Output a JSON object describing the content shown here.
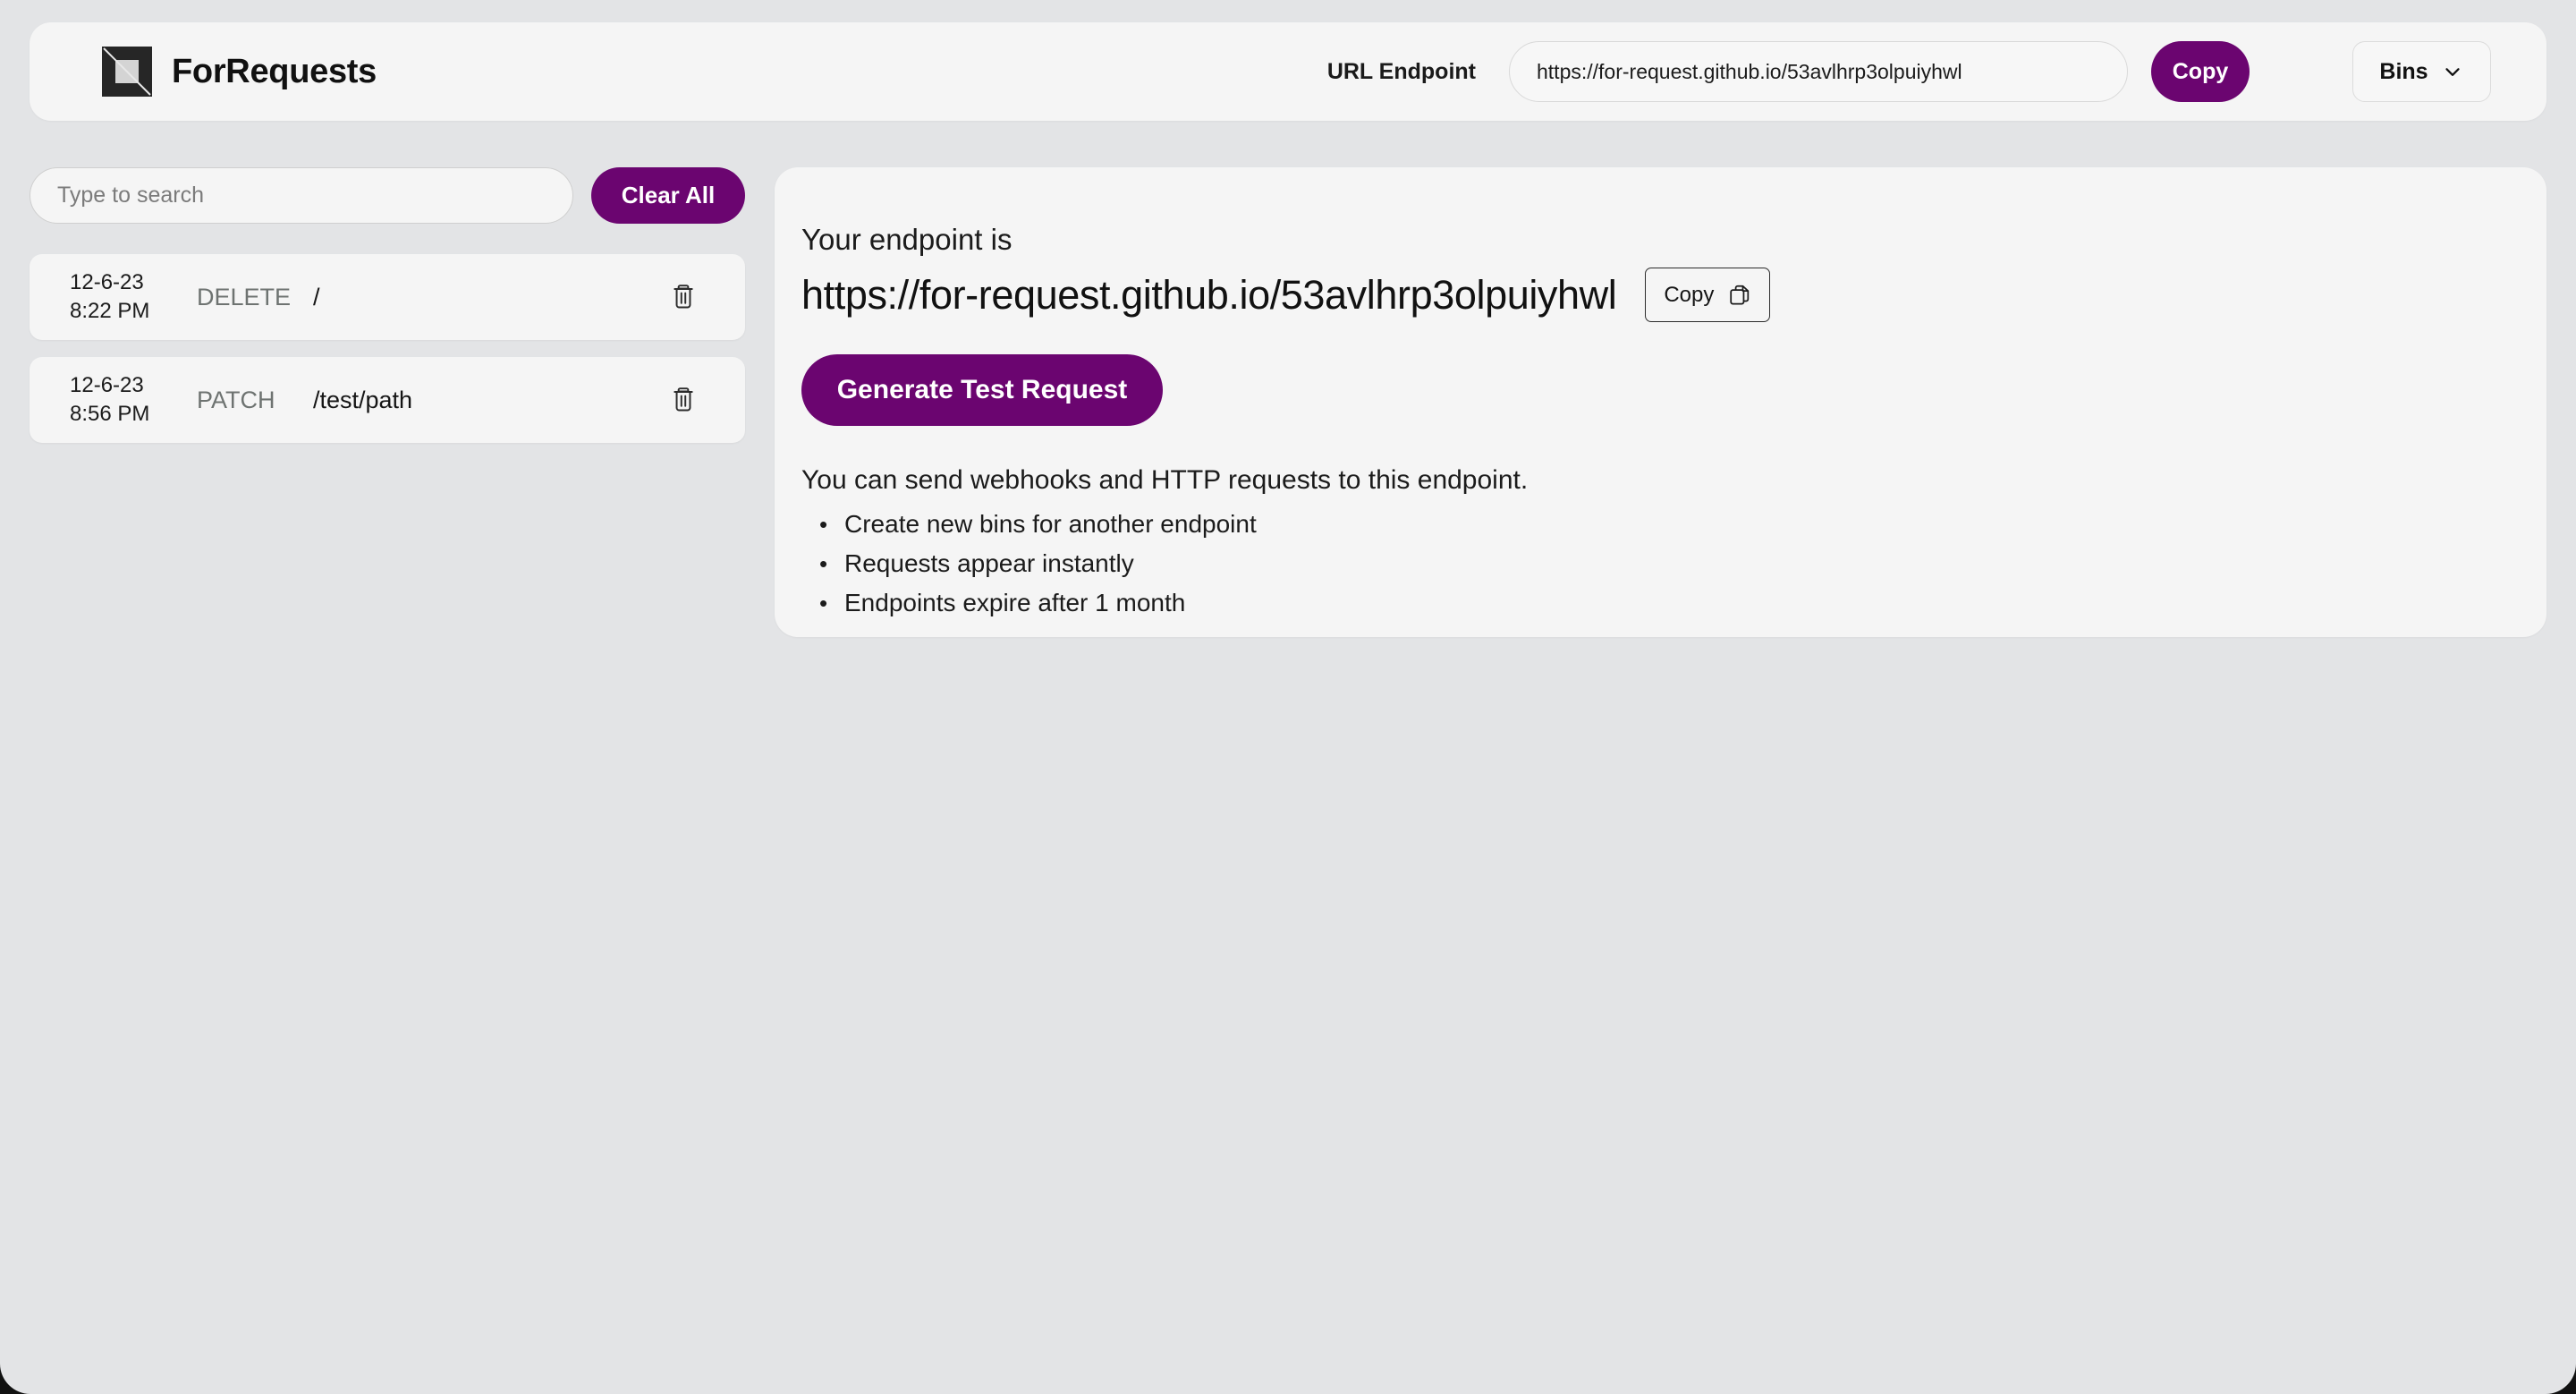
{
  "theme": {
    "accent_purple": "#6b0570",
    "page_background": "#e3e4e6",
    "card_background": "#f5f5f5",
    "text_primary": "#1b1b1b",
    "text_muted": "#6e7371"
  },
  "header": {
    "brand_name": "ForRequests",
    "logo_icon": "square-logo-icon",
    "url_endpoint_label": "URL Endpoint",
    "endpoint_value": "https://for-request.github.io/53avlhrp3olpuiyhwl",
    "endpoint_placeholder": "https://for-request.github.io/53avlhrp3olpuiyhwl",
    "copy_label": "Copy",
    "bins_label": "Bins",
    "bins_chevron_icon": "chevron-down-icon"
  },
  "sidebar": {
    "search_value": "",
    "search_placeholder": "Type to search",
    "clear_all_label": "Clear All",
    "delete_icon": "trash-icon",
    "requests": [
      {
        "date": "12-6-23",
        "time": "8:22 PM",
        "method": "DELETE",
        "path": "/"
      },
      {
        "date": "12-6-23",
        "time": "8:56 PM",
        "method": "PATCH",
        "path": "/test/path"
      }
    ]
  },
  "main": {
    "intro": "Your endpoint is",
    "endpoint_url": "https://for-request.github.io/53avlhrp3olpuiyhwl",
    "copy_label": "Copy",
    "copy_icon": "copy-icon",
    "generate_label": "Generate Test Request",
    "description": "You can send webhooks and HTTP requests to this endpoint.",
    "bullets": [
      "Create new bins for another endpoint",
      "Requests appear instantly",
      "Endpoints expire after 1 month"
    ]
  }
}
